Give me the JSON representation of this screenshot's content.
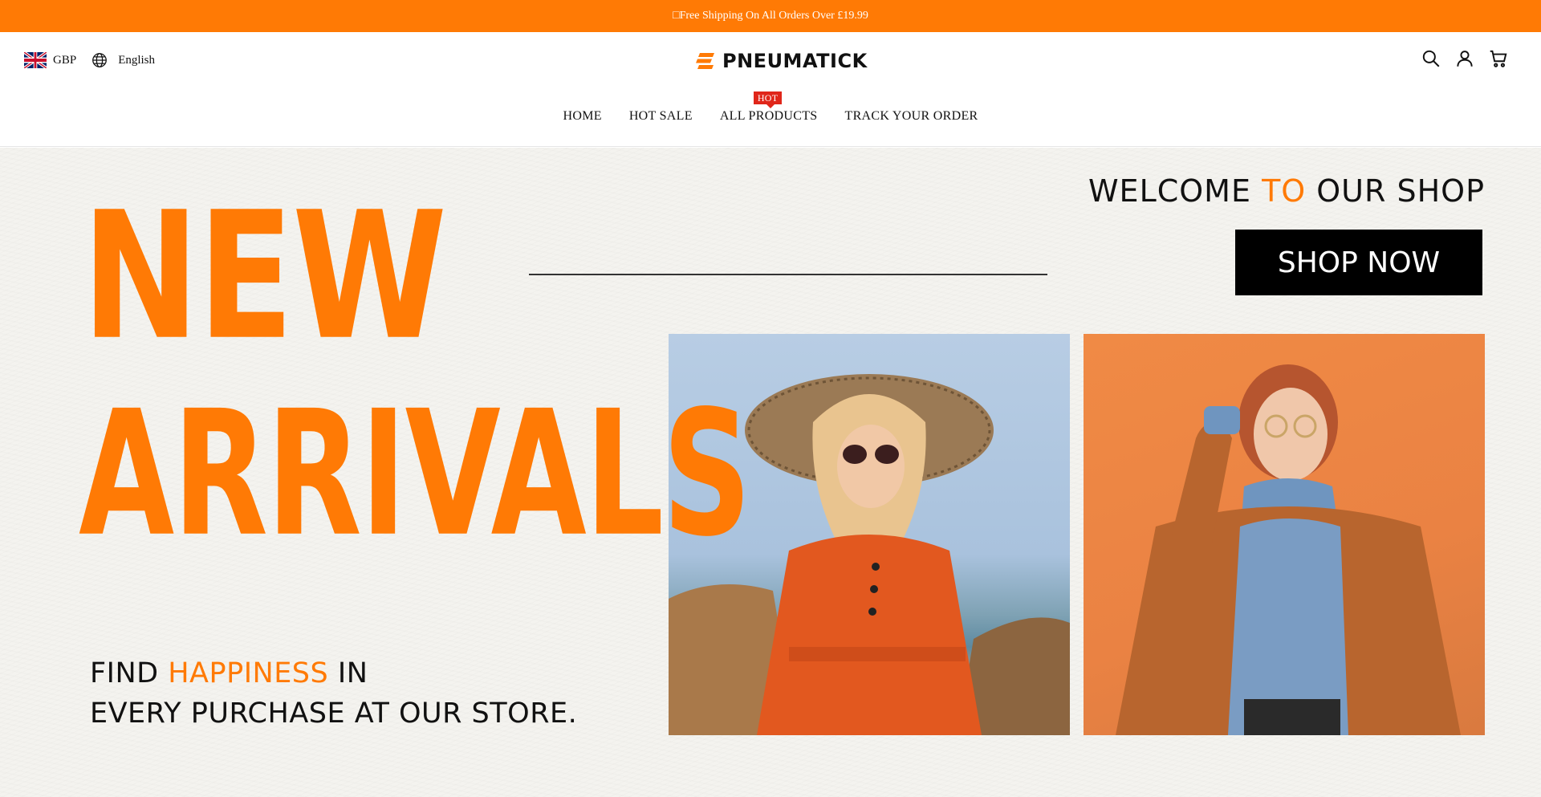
{
  "announcement": {
    "text": "□Free Shipping On All Orders Over £19.99"
  },
  "header": {
    "currency": "GBP",
    "language": "English",
    "logo_text": "PNEUMATICK",
    "icons": [
      "search-icon",
      "account-icon",
      "cart-icon"
    ]
  },
  "nav": {
    "items": [
      {
        "label": "HOME"
      },
      {
        "label": "HOT SALE"
      },
      {
        "label": "ALL PRODUCTS",
        "badge": "HOT"
      },
      {
        "label": "TRACK YOUR ORDER"
      }
    ]
  },
  "hero": {
    "welcome_pre": "WELCOME ",
    "welcome_accent": "TO",
    "welcome_post": " OUR SHOP",
    "cta_label": "SHOP NOW",
    "headline_line1": "NEW",
    "headline_line2": "ARRIVALS",
    "tagline_pre": "FIND ",
    "tagline_accent": "HAPPINESS",
    "tagline_post": " IN",
    "tagline_line2": "EVERY PURCHASE AT OUR STORE."
  },
  "colors": {
    "brand_orange": "#ff7a05",
    "badge_red": "#e0261a",
    "cta_black": "#000000"
  }
}
